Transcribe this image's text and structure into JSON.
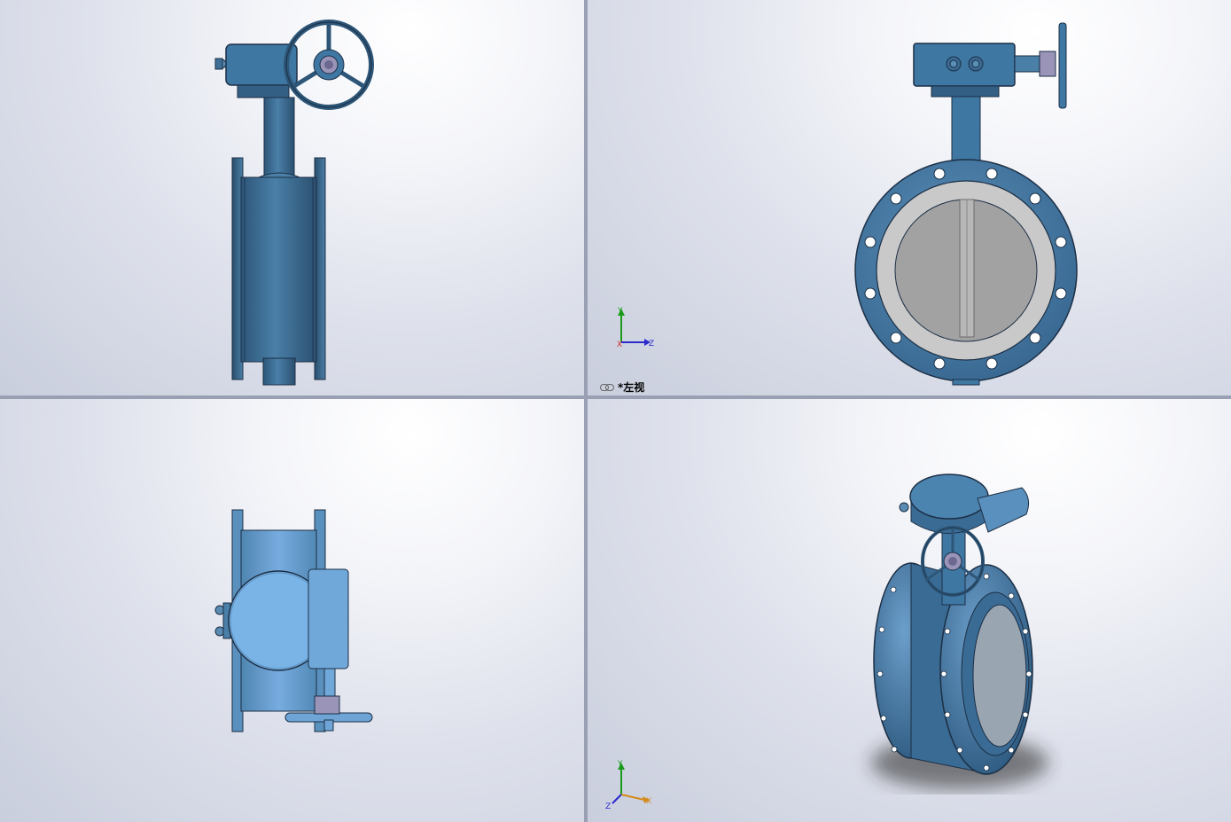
{
  "viewports": {
    "top_left": {
      "name": "front"
    },
    "top_right": {
      "name": "left",
      "label": "*左视"
    },
    "bottom_left": {
      "name": "top"
    },
    "bottom_right": {
      "name": "isometric"
    }
  },
  "triad": {
    "x": "X",
    "y": "Y",
    "z": "Z"
  },
  "colors": {
    "steel_blue": "#3e6f98",
    "dark_outline": "#1c2f45",
    "disc_gray": "#9f9f9f",
    "seat_gray": "#c9c9c9",
    "stem_purple": "#9a94b8"
  },
  "icons": {
    "view_link": "link-icon"
  }
}
